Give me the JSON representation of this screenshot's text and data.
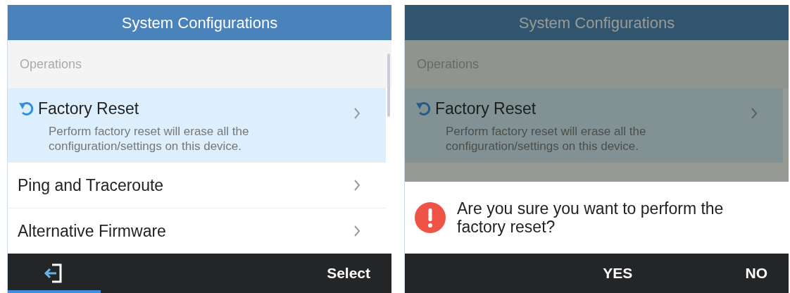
{
  "screens": [
    {
      "title": "System Configurations",
      "dimmed": false,
      "section": "Operations",
      "items": [
        {
          "kind": "reset",
          "label": "Factory Reset",
          "description": "Perform factory reset will erase all the configuration/settings on this device.",
          "selected": true
        },
        {
          "kind": "plain",
          "label": "Ping and Traceroute",
          "selected": false
        },
        {
          "kind": "plain",
          "label": "Alternative Firmware",
          "selected": false
        }
      ],
      "softkeys": [
        {
          "kind": "exit",
          "selected": true
        },
        {
          "kind": "text",
          "label": "Select",
          "selected": false
        }
      ]
    },
    {
      "title": "System Configurations",
      "dimmed": true,
      "section": "Operations",
      "items": [
        {
          "kind": "reset",
          "label": "Factory Reset",
          "description": "Perform factory reset will erase all the configuration/settings on this device.",
          "selected": true
        }
      ],
      "dialog": {
        "message": "Are you sure you want to perform the factory reset?"
      },
      "softkeys": [
        {
          "kind": "spacer"
        },
        {
          "kind": "text",
          "label": "YES",
          "selected": false
        },
        {
          "kind": "text",
          "label": "NO",
          "selected": false
        }
      ]
    }
  ]
}
